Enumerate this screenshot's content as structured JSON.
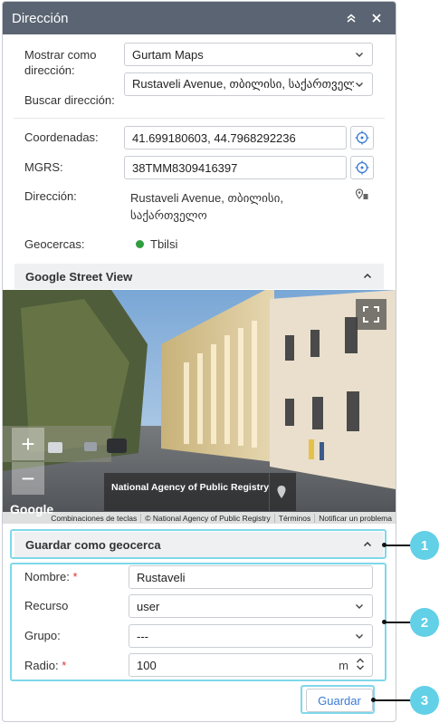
{
  "window": {
    "title": "Dirección"
  },
  "form": {
    "show_as_label": "Mostrar como dirección:",
    "show_as_value": "Gurtam Maps",
    "search_label": "Buscar dirección:",
    "search_value": "Rustaveli Avenue, თბილისი, საქართველო",
    "coords_label": "Coordenadas:",
    "coords_value": "41.699180603, 44.7968292236",
    "mgrs_label": "MGRS:",
    "mgrs_value": "38TMM8309416397",
    "address_label": "Dirección:",
    "address_line1": "Rustaveli Avenue, თბილისი,",
    "address_line2": "საქართველო",
    "geofences_label": "Geocercas:",
    "geofence_name": "Tbilsi",
    "geofence_color": "#2e9e3e"
  },
  "street_view": {
    "title": "Google Street View",
    "sign": "National Agency of Public Registry",
    "logo": "Google",
    "footer": [
      "Combinaciones de teclas",
      "© National Agency of Public Registry",
      "Términos",
      "Notificar un problema"
    ]
  },
  "geofence_form": {
    "title": "Guardar como geocerca",
    "name_label": "Nombre:",
    "name_value": "Rustaveli",
    "resource_label": "Recurso",
    "resource_value": "user",
    "group_label": "Grupo:",
    "group_value": "---",
    "radius_label": "Radio:",
    "radius_value": "100",
    "radius_unit": "m",
    "required_mark": "*",
    "save_label": "Guardar"
  },
  "callouts": [
    "1",
    "2",
    "3"
  ],
  "colors": {
    "titlebar": "#5a6472",
    "callout": "#62d0e6",
    "link": "#3a7bd5"
  }
}
